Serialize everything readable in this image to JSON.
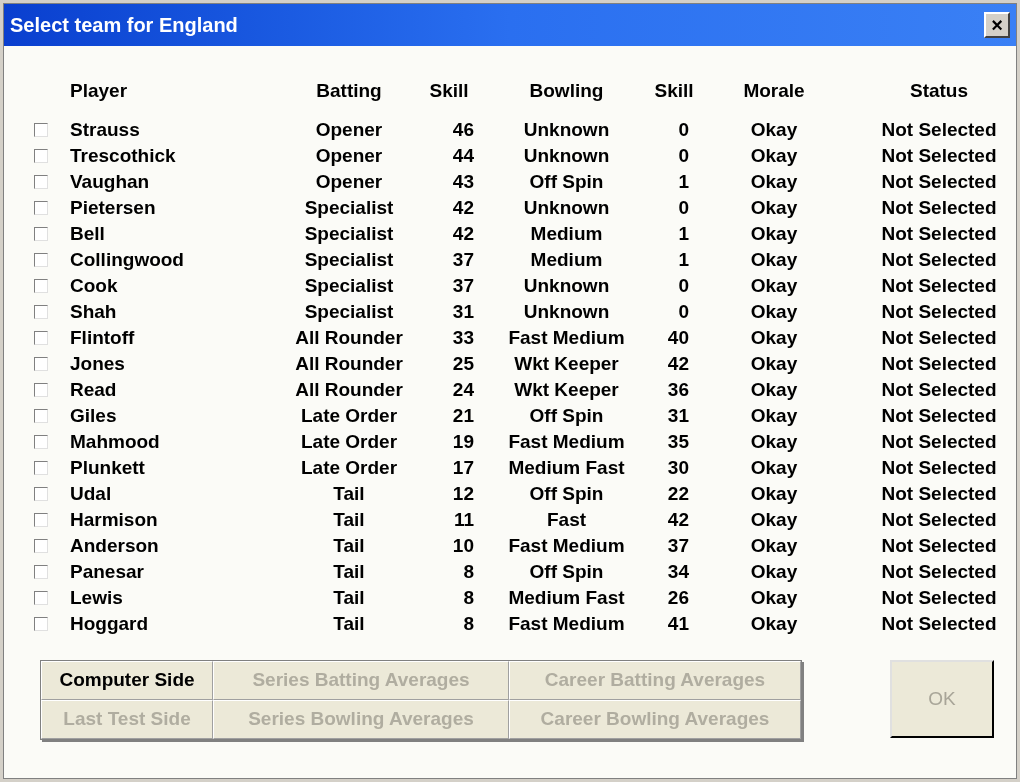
{
  "window": {
    "title": "Select team for England",
    "close": "×"
  },
  "table": {
    "columns": [
      "Player",
      "Batting",
      "Skill",
      "Bowling",
      "Skill",
      "Morale",
      "Status"
    ],
    "rows": [
      {
        "checked": false,
        "cells": [
          "Strauss",
          "Opener",
          "46",
          "Unknown",
          "0",
          "Okay",
          "Not Selected"
        ]
      },
      {
        "checked": false,
        "cells": [
          "Trescothick",
          "Opener",
          "44",
          "Unknown",
          "0",
          "Okay",
          "Not Selected"
        ]
      },
      {
        "checked": false,
        "cells": [
          "Vaughan",
          "Opener",
          "43",
          "Off Spin",
          "1",
          "Okay",
          "Not Selected"
        ]
      },
      {
        "checked": false,
        "cells": [
          "Pietersen",
          "Specialist",
          "42",
          "Unknown",
          "0",
          "Okay",
          "Not Selected"
        ]
      },
      {
        "checked": false,
        "cells": [
          "Bell",
          "Specialist",
          "42",
          "Medium",
          "1",
          "Okay",
          "Not Selected"
        ]
      },
      {
        "checked": false,
        "cells": [
          "Collingwood",
          "Specialist",
          "37",
          "Medium",
          "1",
          "Okay",
          "Not Selected"
        ]
      },
      {
        "checked": false,
        "cells": [
          "Cook",
          "Specialist",
          "37",
          "Unknown",
          "0",
          "Okay",
          "Not Selected"
        ]
      },
      {
        "checked": false,
        "cells": [
          "Shah",
          "Specialist",
          "31",
          "Unknown",
          "0",
          "Okay",
          "Not Selected"
        ]
      },
      {
        "checked": false,
        "cells": [
          "Flintoff",
          "All Rounder",
          "33",
          "Fast Medium",
          "40",
          "Okay",
          "Not Selected"
        ]
      },
      {
        "checked": false,
        "cells": [
          "Jones",
          "All Rounder",
          "25",
          "Wkt Keeper",
          "42",
          "Okay",
          "Not Selected"
        ]
      },
      {
        "checked": false,
        "cells": [
          "Read",
          "All Rounder",
          "24",
          "Wkt Keeper",
          "36",
          "Okay",
          "Not Selected"
        ]
      },
      {
        "checked": false,
        "cells": [
          "Giles",
          "Late Order",
          "21",
          "Off Spin",
          "31",
          "Okay",
          "Not Selected"
        ]
      },
      {
        "checked": false,
        "cells": [
          "Mahmood",
          "Late Order",
          "19",
          "Fast Medium",
          "35",
          "Okay",
          "Not Selected"
        ]
      },
      {
        "checked": false,
        "cells": [
          "Plunkett",
          "Late Order",
          "17",
          "Medium Fast",
          "30",
          "Okay",
          "Not Selected"
        ]
      },
      {
        "checked": false,
        "cells": [
          "Udal",
          "Tail",
          "12",
          "Off Spin",
          "22",
          "Okay",
          "Not Selected"
        ]
      },
      {
        "checked": false,
        "cells": [
          "Harmison",
          "Tail",
          "11",
          "Fast",
          "42",
          "Okay",
          "Not Selected"
        ]
      },
      {
        "checked": false,
        "cells": [
          "Anderson",
          "Tail",
          "10",
          "Fast Medium",
          "37",
          "Okay",
          "Not Selected"
        ]
      },
      {
        "checked": false,
        "cells": [
          "Panesar",
          "Tail",
          "8",
          "Off Spin",
          "34",
          "Okay",
          "Not Selected"
        ]
      },
      {
        "checked": false,
        "cells": [
          "Lewis",
          "Tail",
          "8",
          "Medium Fast",
          "26",
          "Okay",
          "Not Selected"
        ]
      },
      {
        "checked": false,
        "cells": [
          "Hoggard",
          "Tail",
          "8",
          "Fast Medium",
          "41",
          "Okay",
          "Not Selected"
        ]
      }
    ]
  },
  "buttons": [
    {
      "label": "Computer Side",
      "disabled": false
    },
    {
      "label": "Series Batting Averages",
      "disabled": true
    },
    {
      "label": "Career Batting Averages",
      "disabled": true
    },
    {
      "label": "Last Test Side",
      "disabled": true
    },
    {
      "label": "Series Bowling Averages",
      "disabled": true
    },
    {
      "label": "Career Bowling Averages",
      "disabled": true
    }
  ],
  "ok_button": {
    "label": "OK",
    "disabled": true
  }
}
